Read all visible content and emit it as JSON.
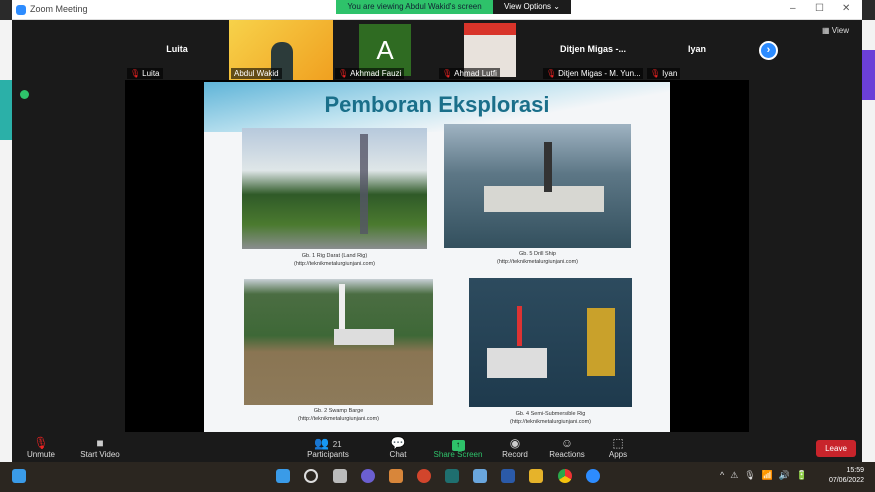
{
  "window": {
    "title": "Zoom Meeting",
    "banner": "You are viewing Abdul Wakid's screen",
    "view_options": "View Options ⌄",
    "view_button": "View"
  },
  "participants": [
    {
      "name": "Luita",
      "label": "Luita"
    },
    {
      "name": "",
      "label": "Abdul Wakid"
    },
    {
      "name": "A",
      "label": "Akhmad Fauzi"
    },
    {
      "name": "",
      "label": "Ahmad Lutfi"
    },
    {
      "name": "Ditjen Migas -...",
      "label": "Ditjen Migas - M. Yun..."
    },
    {
      "name": "Iyan",
      "label": "Iyan"
    }
  ],
  "slide": {
    "title": "Pemboran Eksplorasi",
    "figures": [
      {
        "caption": "Gb. 1 Rig Darat (Land Rig)",
        "source": "(http://teknikmetalurgiunjani.com)"
      },
      {
        "caption": "Gb. 5 Drill Ship",
        "source": "(http://teknikmetalurgiunjani.com)"
      },
      {
        "caption": "Gb. 2 Swamp Barge",
        "source": "(http://teknikmetalurgiunjani.com)"
      },
      {
        "caption": "Gb. 4 Semi-Submersible Rig",
        "source": "(http://teknikmetalurgiunjani.com)"
      }
    ]
  },
  "toolbar": {
    "unmute": "Unmute",
    "start_video": "Start Video",
    "participants": "Participants",
    "participants_count": "21",
    "chat": "Chat",
    "share_screen": "Share Screen",
    "record": "Record",
    "reactions": "Reactions",
    "apps": "Apps",
    "leave": "Leave"
  },
  "taskbar": {
    "time": "15:59",
    "date": "07/06/2022"
  }
}
